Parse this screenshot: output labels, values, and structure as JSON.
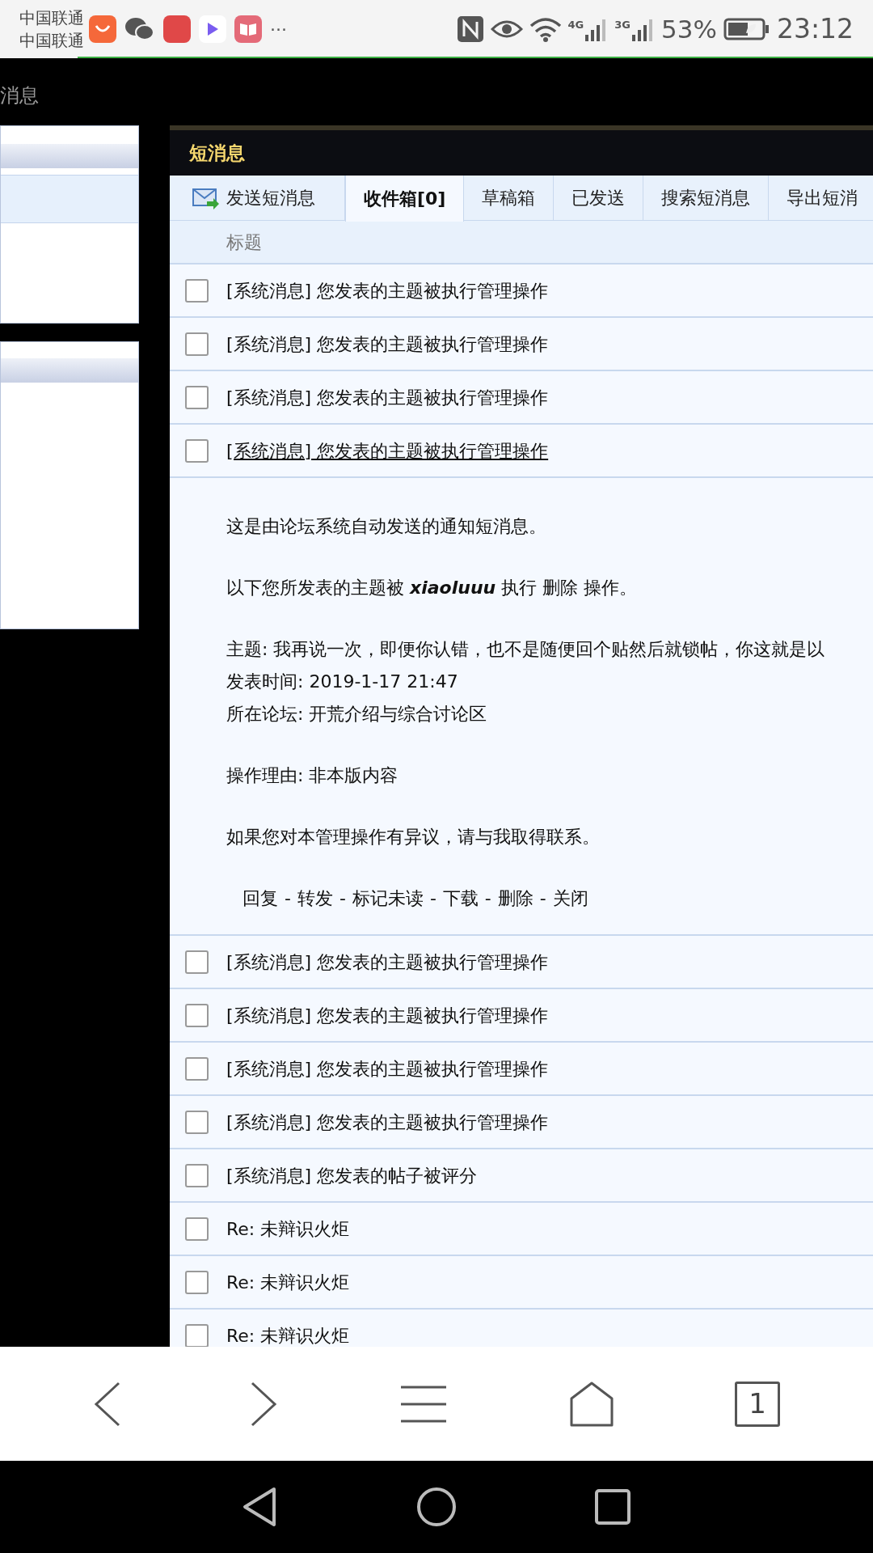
{
  "status_bar": {
    "carriers": [
      "中国联通",
      "中国联通"
    ],
    "more": "···",
    "network_4g": "4G",
    "network_3g": "3G",
    "battery": "53%",
    "time": "23:12"
  },
  "page_title": "消息",
  "panel": {
    "title": "短消息",
    "tabs": [
      {
        "label": "发送短消息",
        "selected": false,
        "kind": "compose"
      },
      {
        "label": "收件箱[0]",
        "selected": true,
        "kind": "plain"
      },
      {
        "label": "草稿箱",
        "selected": false,
        "kind": "plain"
      },
      {
        "label": "已发送",
        "selected": false,
        "kind": "plain"
      },
      {
        "label": "搜索短消息",
        "selected": false,
        "kind": "plain"
      },
      {
        "label": "导出短消",
        "selected": false,
        "kind": "plain"
      }
    ],
    "column_header": "标题",
    "messages": [
      {
        "subject": "[系统消息] 您发表的主题被执行管理操作",
        "checked": false,
        "expanded": false
      },
      {
        "subject": "[系统消息] 您发表的主题被执行管理操作",
        "checked": false,
        "expanded": false
      },
      {
        "subject": "[系统消息] 您发表的主题被执行管理操作",
        "checked": false,
        "expanded": false
      },
      {
        "subject": "[系统消息] 您发表的主题被执行管理操作",
        "checked": false,
        "expanded": true,
        "body": [
          [
            "这是由论坛系统自动发送的通知短消息。"
          ],
          [
            "以下您所发表的主题被 **xiaoluuu** 执行 删除 操作。"
          ],
          [
            "主题: 我再说一次，即便你认错，也不是随便回个贴然后就锁帖，你这就是以",
            "发表时间: 2019-1-17 21:47",
            "所在论坛: 开荒介绍与综合讨论区"
          ],
          [
            "操作理由: 非本版内容"
          ],
          [
            "如果您对本管理操作有异议，请与我取得联系。"
          ]
        ],
        "actions": [
          "回复",
          "转发",
          "标记未读",
          "下载",
          "删除",
          "关闭"
        ],
        "action_separator": "-"
      },
      {
        "subject": "[系统消息] 您发表的主题被执行管理操作",
        "checked": false,
        "expanded": false
      },
      {
        "subject": "[系统消息] 您发表的主题被执行管理操作",
        "checked": false,
        "expanded": false
      },
      {
        "subject": "[系统消息] 您发表的主题被执行管理操作",
        "checked": false,
        "expanded": false
      },
      {
        "subject": "[系统消息] 您发表的主题被执行管理操作",
        "checked": false,
        "expanded": false
      },
      {
        "subject": "[系统消息] 您发表的帖子被评分",
        "checked": false,
        "expanded": false
      },
      {
        "subject": "Re: 未辩识火炬",
        "checked": false,
        "expanded": false
      },
      {
        "subject": "Re: 未辩识火炬",
        "checked": false,
        "expanded": false
      },
      {
        "subject": "Re: 未辩识火炬",
        "checked": false,
        "expanded": false
      }
    ]
  },
  "browser_bar": {
    "tab_count": "1"
  }
}
